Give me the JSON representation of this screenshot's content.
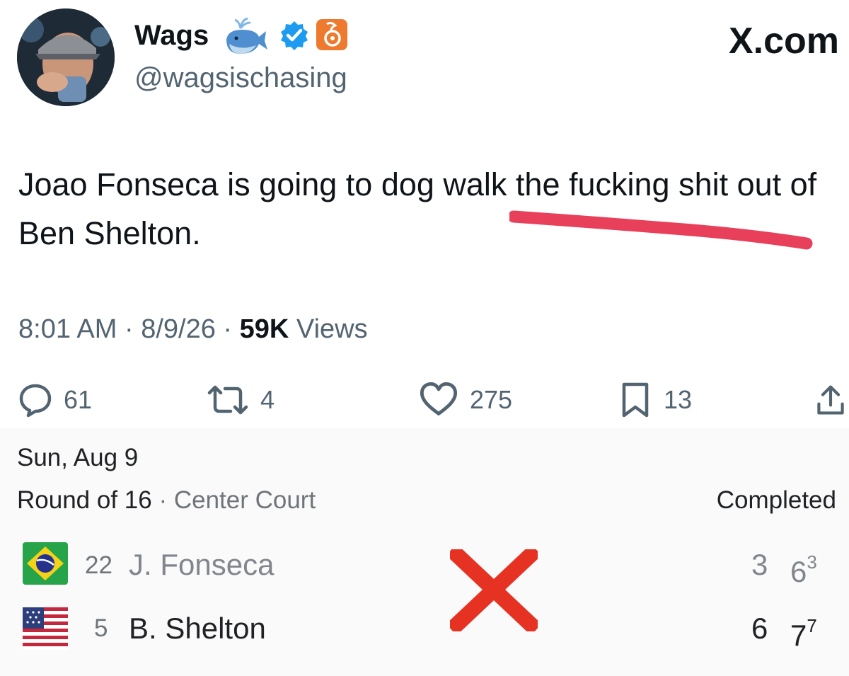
{
  "tweet": {
    "display_name": "Wags",
    "handle": "@wagsischasing",
    "site_logo": "X.com",
    "text": "Joao Fonseca is going to dog walk the fucking shit out of Ben Shelton.",
    "time": "8:01 AM",
    "date": "8/9/26",
    "views_count": "59K",
    "views_label": "Views",
    "reply_count": "61",
    "retweet_count": "4",
    "like_count": "275",
    "bookmark_count": "13",
    "icons": [
      "avatar",
      "whale-icon",
      "verified-icon",
      "brand-icon",
      "reply-icon",
      "retweet-icon",
      "like-icon",
      "bookmark-icon",
      "share-icon"
    ],
    "accent_color": "#1d9bf0",
    "underline_color": "#e8405a"
  },
  "match": {
    "date": "Sun, Aug 9",
    "round": "Round of 16",
    "court": "Center Court",
    "status": "Completed",
    "players": [
      {
        "seed": "22",
        "name": "J. Fonseca",
        "flag": "brazil-flag-icon",
        "set1": "3",
        "set2": "6",
        "set2_tiebreak": "3"
      },
      {
        "seed": "5",
        "name": "B. Shelton",
        "flag": "usa-flag-icon",
        "set1": "6",
        "set2": "7",
        "set2_tiebreak": "7"
      }
    ],
    "overlay_mark": "red-x-icon",
    "overlay_color": "#e53223"
  }
}
